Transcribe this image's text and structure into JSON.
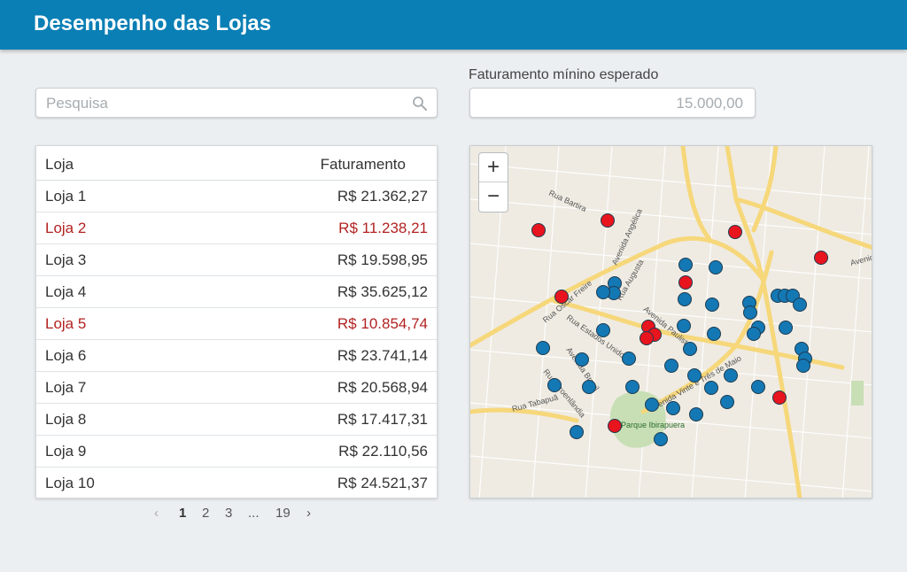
{
  "app": {
    "title": "Desempenho das Lojas"
  },
  "search": {
    "placeholder": "Pesquisa"
  },
  "revenue_filter": {
    "label": "Faturamento mínino esperado",
    "value": "15.000,00"
  },
  "table": {
    "headers": [
      "Loja",
      "Faturamento"
    ],
    "rows": [
      {
        "name": "Loja 1",
        "revenue": "R$ 21.362,27",
        "below_target": false
      },
      {
        "name": "Loja 2",
        "revenue": "R$ 11.238,21",
        "below_target": true
      },
      {
        "name": "Loja 3",
        "revenue": "R$ 19.598,95",
        "below_target": false
      },
      {
        "name": "Loja 4",
        "revenue": "R$ 35.625,12",
        "below_target": false
      },
      {
        "name": "Loja 5",
        "revenue": "R$ 10.854,74",
        "below_target": true
      },
      {
        "name": "Loja 6",
        "revenue": "R$ 23.741,14",
        "below_target": false
      },
      {
        "name": "Loja 7",
        "revenue": "R$ 20.568,94",
        "below_target": false
      },
      {
        "name": "Loja 8",
        "revenue": "R$ 17.417,31",
        "below_target": false
      },
      {
        "name": "Loja 9",
        "revenue": "R$ 22.110,56",
        "below_target": false
      },
      {
        "name": "Loja 10",
        "revenue": "R$ 24.521,37",
        "below_target": false
      }
    ]
  },
  "pagination": {
    "prev": "‹",
    "pages": [
      "1",
      "2",
      "3",
      "...",
      "19"
    ],
    "current": "1",
    "next": "›"
  },
  "map": {
    "zoom_in": "+",
    "zoom_out": "−",
    "street_labels": [
      "Rua Bartira",
      "Avenida Angélica",
      "Rua Augusta",
      "Rua Oscar Freire",
      "Avenida Paulista",
      "Rua Estados Unidos",
      "Avenida Brasil",
      "Rua Groenlândia",
      "Rua Tabapuã",
      "Parque Ibirapuera",
      "Avenida Vinte e Três de Maio",
      "Avenida"
    ],
    "marker_colors": {
      "above_target": "#1478b4",
      "below_target": "#e8141e"
    }
  },
  "colors": {
    "header": "#0a7fb5",
    "below_target_text": "#b22222"
  }
}
